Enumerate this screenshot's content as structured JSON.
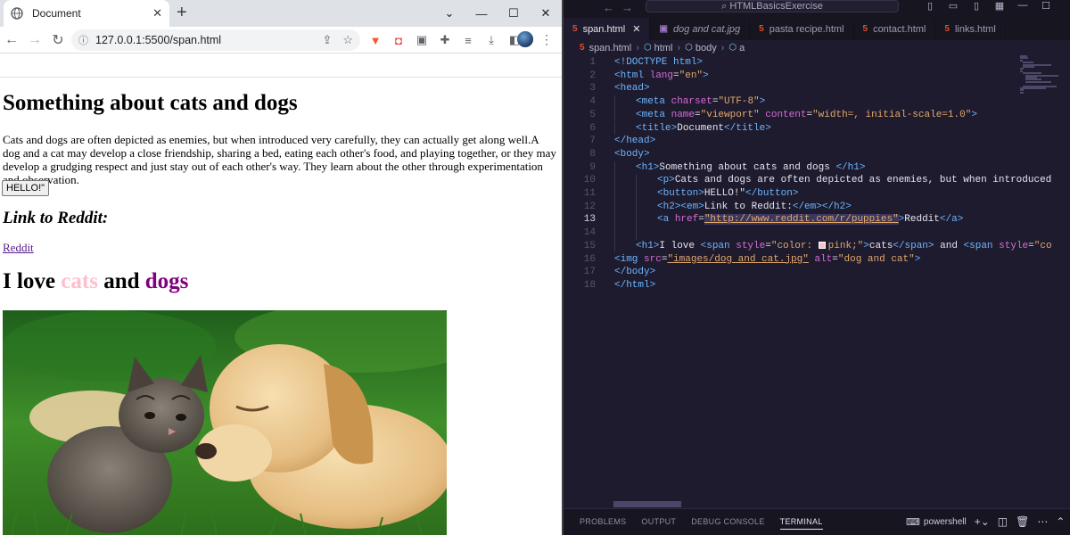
{
  "browser": {
    "tab_title": "Document",
    "url": "127.0.0.1:5500/span.html",
    "page": {
      "h1": "Something about cats and dogs",
      "paragraph": "Cats and dogs are often depicted as enemies, but when introduced very carefully, they can actually get along well.A dog and a cat may develop a close friendship, sharing a bed, eating each other's food, and playing together, or they may develop a grudging respect and just stay out of each other's way. They learn about the other through experimentation and observation.",
      "button_label": "HELLO!\"",
      "h2": "Link to Reddit:",
      "link_text": "Reddit",
      "love_prefix": "I love ",
      "love_cats": "cats",
      "love_and": " and ",
      "love_dogs": "dogs",
      "image_alt": "dog and cat"
    }
  },
  "vscode": {
    "title_search": "HTMLBasicsExercise",
    "tabs": [
      {
        "name": "span.html",
        "active": true
      },
      {
        "name": "dog and cat.jpg",
        "active": false
      },
      {
        "name": "pasta recipe.html",
        "active": false
      },
      {
        "name": "contact.html",
        "active": false
      },
      {
        "name": "links.html",
        "active": false
      }
    ],
    "breadcrumb": [
      "span.html",
      "html",
      "body",
      "a"
    ],
    "current_line": 13,
    "code_lines": [
      {
        "n": 1,
        "indent": 0,
        "parts": [
          [
            "tg",
            "<!DOCTYPE html>"
          ]
        ]
      },
      {
        "n": 2,
        "indent": 0,
        "parts": [
          [
            "tg",
            "<html "
          ],
          [
            "at",
            "lang"
          ],
          [
            "t",
            "="
          ],
          [
            "sv",
            "\"en\""
          ],
          [
            "tg",
            ">"
          ]
        ]
      },
      {
        "n": 3,
        "indent": 0,
        "parts": [
          [
            "tg",
            "<head>"
          ]
        ]
      },
      {
        "n": 4,
        "indent": 1,
        "parts": [
          [
            "tg",
            "<meta "
          ],
          [
            "at",
            "charset"
          ],
          [
            "t",
            "="
          ],
          [
            "sv",
            "\"UTF-8\""
          ],
          [
            "tg",
            ">"
          ]
        ]
      },
      {
        "n": 5,
        "indent": 1,
        "parts": [
          [
            "tg",
            "<meta "
          ],
          [
            "at",
            "name"
          ],
          [
            "t",
            "="
          ],
          [
            "sv",
            "\"viewport\" "
          ],
          [
            "at",
            "content"
          ],
          [
            "t",
            "="
          ],
          [
            "sv",
            "\"width=, initial-scale=1.0\""
          ],
          [
            "tg",
            ">"
          ]
        ]
      },
      {
        "n": 6,
        "indent": 1,
        "parts": [
          [
            "tg",
            "<title>"
          ],
          [
            "t",
            "Document"
          ],
          [
            "tg",
            "</title>"
          ]
        ]
      },
      {
        "n": 7,
        "indent": 0,
        "parts": [
          [
            "tg",
            "</head>"
          ]
        ]
      },
      {
        "n": 8,
        "indent": 0,
        "parts": [
          [
            "tg",
            "<body>"
          ]
        ]
      },
      {
        "n": 9,
        "indent": 1,
        "parts": [
          [
            "tg",
            "<h1>"
          ],
          [
            "t",
            "Something about cats and dogs "
          ],
          [
            "tg",
            "</h1>"
          ]
        ]
      },
      {
        "n": 10,
        "indent": 2,
        "parts": [
          [
            "tg",
            "<p>"
          ],
          [
            "t",
            "Cats and dogs are often depicted as enemies, but when introduced"
          ]
        ]
      },
      {
        "n": 11,
        "indent": 2,
        "parts": [
          [
            "tg",
            "<button>"
          ],
          [
            "t",
            "HELLO!\""
          ],
          [
            "tg",
            "</button>"
          ]
        ]
      },
      {
        "n": 12,
        "indent": 2,
        "parts": [
          [
            "tg",
            "<h2><em>"
          ],
          [
            "t",
            "Link to Reddit:"
          ],
          [
            "tg",
            "</em></h2>"
          ]
        ]
      },
      {
        "n": 13,
        "indent": 2,
        "parts": [
          [
            "tg",
            "<a "
          ],
          [
            "at",
            "href"
          ],
          [
            "t",
            "="
          ],
          [
            "lk",
            "\"http://www.reddit.com/r/puppies\""
          ],
          [
            "tg",
            ">"
          ],
          [
            "t",
            "Reddit"
          ],
          [
            "tg",
            "</a>"
          ]
        ]
      },
      {
        "n": 14,
        "indent": 2,
        "parts": []
      },
      {
        "n": 15,
        "indent": 1,
        "parts": [
          [
            "tg",
            "<h1>"
          ],
          [
            "t",
            "I love "
          ],
          [
            "tg",
            "<span "
          ],
          [
            "at",
            "style"
          ],
          [
            "t",
            "="
          ],
          [
            "sv",
            "\"color: "
          ],
          [
            "sw",
            ""
          ],
          [
            "sv",
            "pink;\""
          ],
          [
            "tg",
            ">"
          ],
          [
            "t",
            "cats"
          ],
          [
            "tg",
            "</span>"
          ],
          [
            "t",
            " and "
          ],
          [
            "tg",
            "<span "
          ],
          [
            "at",
            "style"
          ],
          [
            "t",
            "="
          ],
          [
            "sv",
            "\"co"
          ]
        ]
      },
      {
        "n": 16,
        "indent": 0,
        "parts": [
          [
            "tg",
            "<img "
          ],
          [
            "at",
            "src"
          ],
          [
            "t",
            "="
          ],
          [
            "lk",
            "\"images/dog and cat.jpg\""
          ],
          [
            "t",
            " "
          ],
          [
            "at",
            "alt"
          ],
          [
            "t",
            "="
          ],
          [
            "sv",
            "\"dog and cat\""
          ],
          [
            "tg",
            ">"
          ]
        ]
      },
      {
        "n": 17,
        "indent": 0,
        "parts": [
          [
            "tg",
            "</body>"
          ]
        ]
      },
      {
        "n": 18,
        "indent": 0,
        "parts": [
          [
            "tg",
            "</html>"
          ]
        ]
      }
    ],
    "panel_tabs": [
      "PROBLEMS",
      "OUTPUT",
      "DEBUG CONSOLE",
      "TERMINAL"
    ],
    "active_panel": "TERMINAL",
    "shell": "powershell"
  },
  "colors": {
    "editor_bg": "#1e1b2e",
    "tag": "#6cb6ff",
    "attr": "#d96ad6",
    "string": "#e3a86c",
    "cats": "pink",
    "dogs": "purple"
  }
}
